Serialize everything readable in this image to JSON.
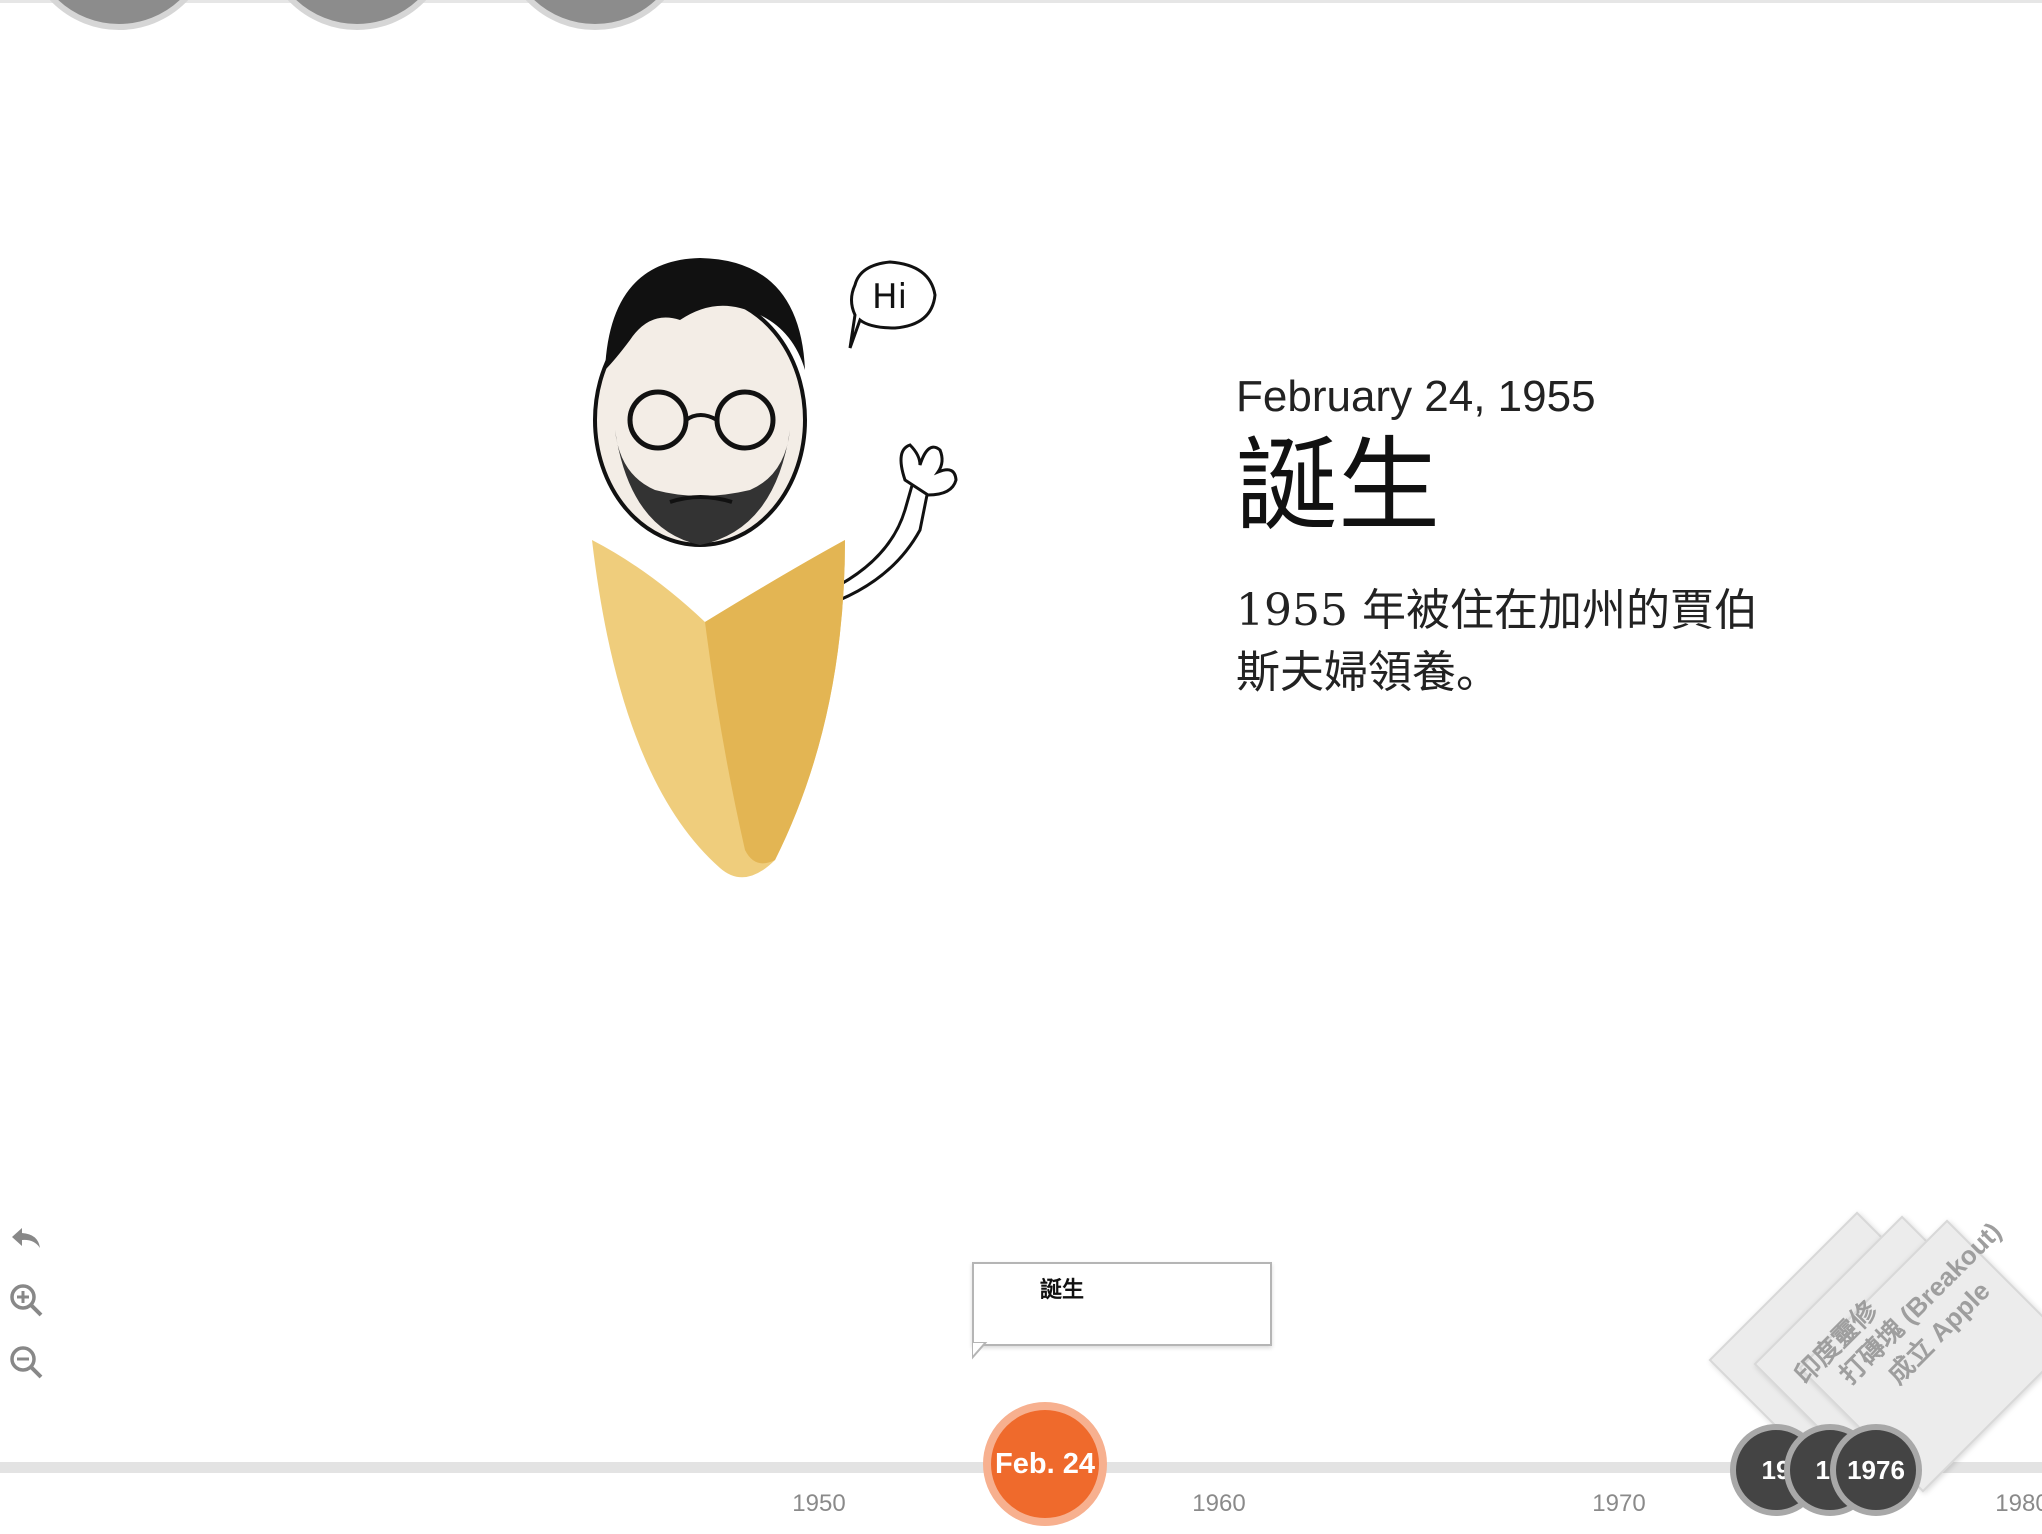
{
  "event": {
    "date": "February 24, 1955",
    "title": "誕生",
    "description": "1955 年被住在加州的賈伯斯夫婦領養。"
  },
  "portrait": {
    "speech_bubble": "Hi"
  },
  "tools": {
    "back": "back-icon",
    "zoom_in": "zoom-in-icon",
    "zoom_out": "zoom-out-icon"
  },
  "flag": {
    "label": "誕生"
  },
  "timeline": {
    "ticks": [
      "1950",
      "1960",
      "1970",
      "1980"
    ],
    "active_marker": "Feb. 24",
    "markers": [
      "19",
      "19",
      "1976"
    ],
    "cards": [
      "印度靈修",
      "打磚塊 (Breakout)",
      "成立 Apple"
    ]
  },
  "colors": {
    "accent": "#ef6a2c",
    "marker": "#444444",
    "shirt": "#e6b552"
  }
}
